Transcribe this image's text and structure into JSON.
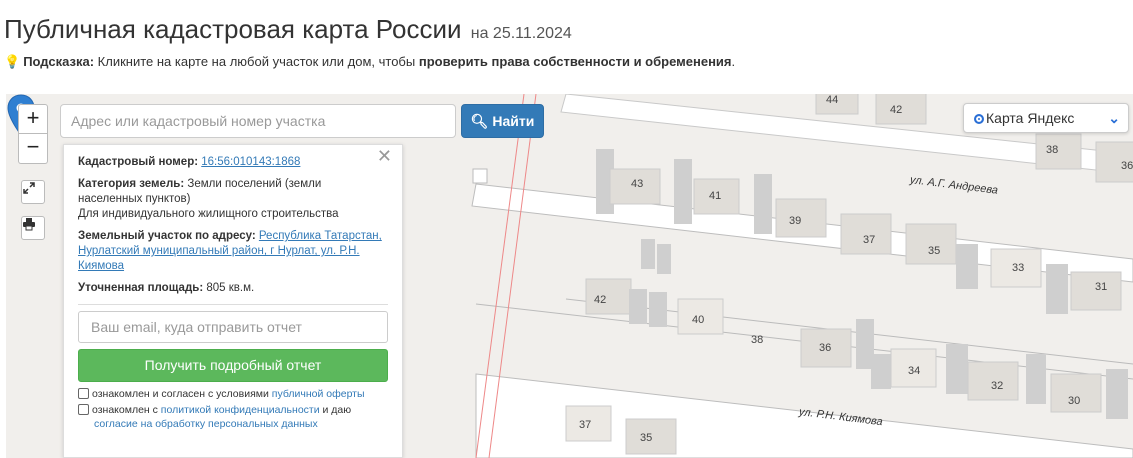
{
  "header": {
    "title": "Публичная кадастровая карта России",
    "date": "на 25.11.2024"
  },
  "hint": {
    "label": "Подсказка:",
    "text_before": " Кликните на карте на любой участок или дом, чтобы ",
    "emphasis": "проверить права собственности и обременения",
    "text_after": "."
  },
  "search": {
    "placeholder": "Адрес или кадастровый номер участка",
    "button_label": "Найти"
  },
  "map_controls": {
    "zoom_in": "+",
    "zoom_out": "−"
  },
  "layer_select": {
    "selected": "Карта Яндекс"
  },
  "info": {
    "cadastral_label": "Кадастровый номер:",
    "cadastral_value": "16:56:010143:1868",
    "category_label": "Категория земель:",
    "category_value": "Земли поселений (земли населенных пунктов)",
    "usage": "Для индивидуального жилищного строительства",
    "address_label": "Земельный участок по адресу:",
    "address_value": "Республика Татарстан, Нурлатский муниципальный район, г Нурлат, ул. Р.Н. Киямова",
    "area_label": "Уточненная площадь:",
    "area_value": "805 кв.м.",
    "email_placeholder": "Ваш email, куда отправить отчет",
    "report_button": "Получить подробный отчет",
    "consent1_before": "ознакомлен и согласен с условиями ",
    "consent1_link": "публичной оферты",
    "consent2_before": "ознакомлен с ",
    "consent2_link": "политикой конфиденциальности",
    "consent2_after": " и даю",
    "consent2_line2": "согласие на обработку персональных данных"
  },
  "map": {
    "streets": [
      "ул. А.Г. Андреева",
      "ул. Р.Н. Киямова"
    ],
    "house_numbers": [
      "44",
      "42",
      "38",
      "36",
      "43",
      "41",
      "39",
      "37",
      "35",
      "33",
      "31",
      "42",
      "40",
      "38",
      "36",
      "34",
      "32",
      "30",
      "37",
      "35"
    ],
    "pin_color": "#2f7fd1"
  }
}
